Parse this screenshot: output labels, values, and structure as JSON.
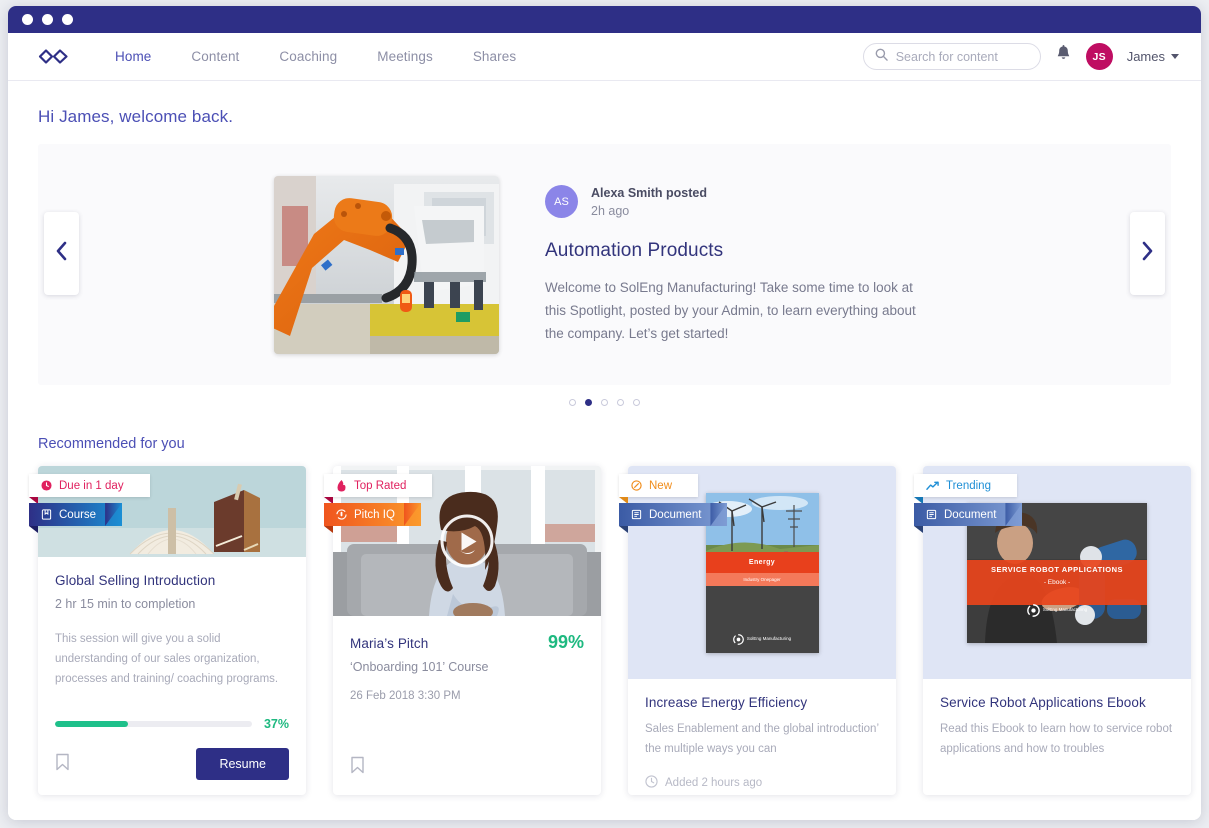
{
  "window": {
    "title_dots": 3
  },
  "nav": {
    "logo_icon": "infinity-logo-icon",
    "links": [
      {
        "label": "Home",
        "active": true
      },
      {
        "label": "Content",
        "active": false
      },
      {
        "label": "Coaching",
        "active": false
      },
      {
        "label": "Meetings",
        "active": false
      },
      {
        "label": "Shares",
        "active": false
      }
    ],
    "search": {
      "placeholder": "Search for content",
      "value": "",
      "icon": "search-icon"
    },
    "notifications_icon": "bell-icon",
    "user": {
      "initials": "JS",
      "name": "James",
      "caret": "chevron-down-icon",
      "avatar_color": "#bf0d62"
    }
  },
  "page": {
    "greeting": "Hi James, welcome back.",
    "section_title": "Recommended for you"
  },
  "hero": {
    "image_alt": "orange industrial robot arm on automotive assembly line",
    "poster": {
      "initials": "AS",
      "name": "Alexa Smith posted",
      "time": "2h ago",
      "avatar_color": "#8b85e8"
    },
    "title": "Automation Products",
    "description": "Welcome to SolEng Manufacturing! Take some time to look at this Spotlight, posted by your Admin, to learn everything about the company. Let’s get started!",
    "prev_icon": "chevron-left-icon",
    "next_icon": "chevron-right-icon",
    "dots": {
      "count": 5,
      "active_index": 1
    }
  },
  "cards": [
    {
      "id": "global-selling-introduction",
      "status_badge": {
        "label": "Due in 1 day",
        "icon": "clock-icon",
        "color": "#e0215f"
      },
      "kind_badge": {
        "label": "Course",
        "icon": "book-icon",
        "color": "#2e2f86"
      },
      "thumb_alt": "open books on teal background",
      "title": "Global Selling Introduction",
      "subtitle": "2 hr 15 min to completion",
      "description": "This session will give you a solid understanding of our sales organization, processes and training/ coaching programs.",
      "progress_pct": 37,
      "progress_label": "37%",
      "progress_color": "#1ec08a",
      "bookmark_icon": "bookmark-icon",
      "action_label": "Resume"
    },
    {
      "id": "marias-pitch",
      "status_badge": {
        "label": "Top Rated",
        "icon": "flame-icon",
        "color": "#e0215f"
      },
      "kind_badge": {
        "label": "Pitch IQ",
        "icon": "mic-icon",
        "color": "#f0551e"
      },
      "thumb_alt": "woman seated on grey couch in bright room, video thumbnail",
      "play_icon": "play-icon",
      "title": "Maria’s Pitch",
      "score": "99%",
      "score_color": "#1eb980",
      "subtitle": "‘Onboarding 101’ Course",
      "date": "26 Feb 2018 3:30 PM",
      "bookmark_icon": "bookmark-icon"
    },
    {
      "id": "increase-energy-efficiency",
      "status_badge": {
        "label": "New",
        "icon": "new-badge-icon",
        "color": "#f08d1c"
      },
      "kind_badge": {
        "label": "Document",
        "icon": "document-icon",
        "color": "#3b5ba5"
      },
      "thumb_alt": "document cover: wind turbines, solar panels and refinery",
      "doc_cover": {
        "band": "Energy",
        "subband": "Industry Onepager",
        "logo": "SolEng Manufacturing"
      },
      "title": "Increase Energy Efficiency",
      "description": "Sales Enablement and the global introduction’ the multiple ways you can",
      "meta": {
        "icon": "clock-icon",
        "label": "Added 2 hours ago"
      }
    },
    {
      "id": "service-robot-applications-ebook",
      "status_badge": {
        "label": "Trending",
        "icon": "trending-up-icon",
        "color": "#1f8fd6"
      },
      "kind_badge": {
        "label": "Document",
        "icon": "document-icon",
        "color": "#3b5ba5"
      },
      "thumb_alt": "document cover: technician working with blue robot arm",
      "doc_cover": {
        "band": "SERVICE ROBOT APPLICATIONS",
        "subband": "- Ebook -",
        "logo": "SolEng Manufacturing"
      },
      "title": "Service Robot Applications Ebook",
      "description": "Read this Ebook to learn how to service robot applications and how to troubles"
    }
  ],
  "colors": {
    "brand_indigo": "#2e2f86",
    "brand_link": "#4b4fb5",
    "accent_pink": "#bf0d62",
    "success_green": "#1eb980",
    "muted_text": "#8a8c9e"
  }
}
